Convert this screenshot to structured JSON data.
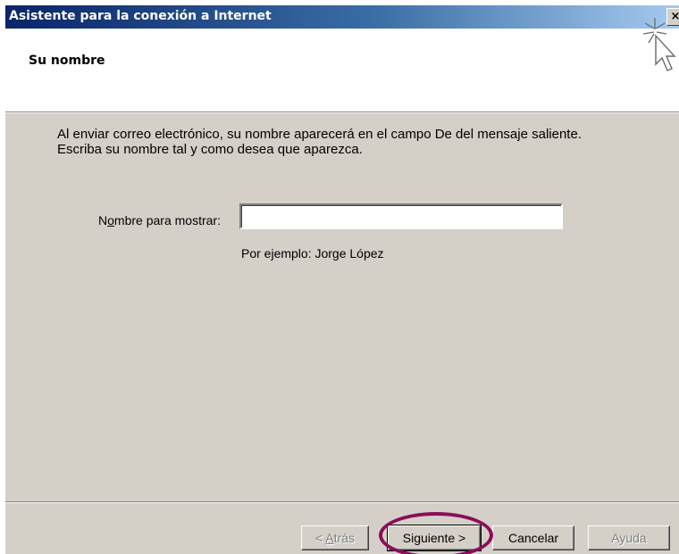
{
  "window": {
    "title": "Asistente para la conexión a Internet",
    "close_glyph": "×"
  },
  "header": {
    "title": "Su nombre",
    "icon": "wizard-sparkle-cursor-icon"
  },
  "description": "Al enviar correo electrónico, su nombre aparecerá en el campo De del mensaje saliente. Escriba su nombre tal y como desea que aparezca.",
  "form": {
    "label_prefix": "N",
    "label_mnemonic": "o",
    "label_rest": "mbre para mostrar:",
    "value": "",
    "example": "Por ejemplo: Jorge López"
  },
  "buttons": {
    "back_prefix": "< ",
    "back_mnemonic": "A",
    "back_rest": "trás",
    "next": "Siguiente >",
    "cancel": "Cancelar",
    "help": "Ayuda"
  },
  "annotation": {
    "highlight_color": "#8b0d5a"
  }
}
